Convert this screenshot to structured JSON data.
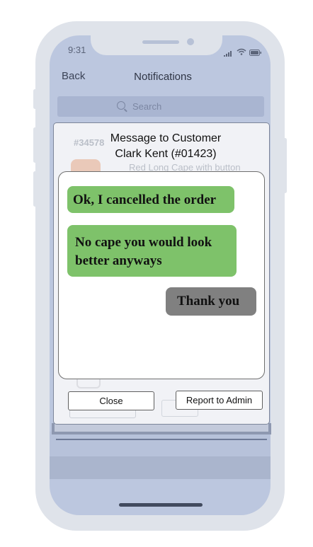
{
  "status_bar": {
    "time": "9:31",
    "icons": [
      "signal-icon",
      "wifi-icon",
      "battery-icon"
    ]
  },
  "nav": {
    "back_label": "Back",
    "title": "Notifications"
  },
  "search": {
    "placeholder": "Search"
  },
  "background_list": {
    "order_id": "#34578",
    "item_name": "Red Long Cape with button"
  },
  "dialog": {
    "title_line1": "Message to Customer",
    "title_line2": "Clark Kent (#01423)",
    "messages": [
      {
        "sender": "customer",
        "text": "Ok, I cancelled the order"
      },
      {
        "sender": "customer",
        "text": "No cape you would look better anyways"
      },
      {
        "sender": "user",
        "text": "Thank you"
      }
    ],
    "close_label": "Close",
    "report_label": "Report to Admin"
  },
  "colors": {
    "customer_bubble": "#7ec26a",
    "user_bubble": "#808080",
    "screen_bg": "#bcc7df",
    "frame": "#dfe3ea"
  }
}
